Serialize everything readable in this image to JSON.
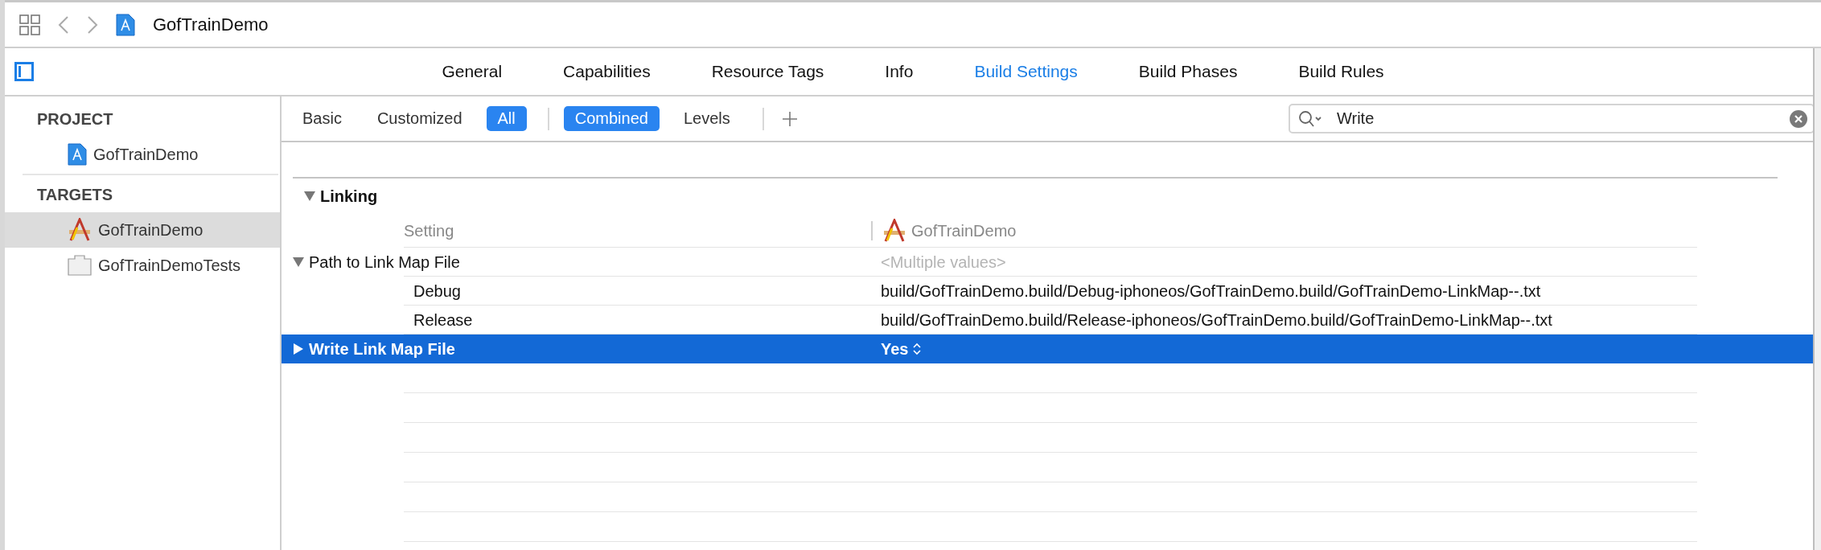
{
  "toolbar": {
    "title": "GofTrainDemo"
  },
  "tabs": [
    {
      "label": "General",
      "selected": false
    },
    {
      "label": "Capabilities",
      "selected": false
    },
    {
      "label": "Resource Tags",
      "selected": false
    },
    {
      "label": "Info",
      "selected": false
    },
    {
      "label": "Build Settings",
      "selected": true
    },
    {
      "label": "Build Phases",
      "selected": false
    },
    {
      "label": "Build Rules",
      "selected": false
    }
  ],
  "sidebar": {
    "sections": [
      {
        "heading": "PROJECT",
        "items": [
          {
            "label": "GofTrainDemo",
            "kind": "project",
            "selected": false
          }
        ]
      },
      {
        "heading": "TARGETS",
        "items": [
          {
            "label": "GofTrainDemo",
            "kind": "app",
            "selected": true
          },
          {
            "label": "GofTrainDemoTests",
            "kind": "tests",
            "selected": false
          }
        ]
      }
    ]
  },
  "filters": {
    "scope": [
      {
        "label": "Basic",
        "selected": false
      },
      {
        "label": "Customized",
        "selected": false
      },
      {
        "label": "All",
        "selected": true
      }
    ],
    "view": [
      {
        "label": "Combined",
        "selected": true
      },
      {
        "label": "Levels",
        "selected": false
      }
    ]
  },
  "search": {
    "value": "Write"
  },
  "settings": {
    "section": {
      "title": "Linking",
      "expanded": true
    },
    "columns": {
      "setting": "Setting",
      "target": "GofTrainDemo"
    },
    "rows": [
      {
        "name": "Path to Link Map File",
        "value": "<Multiple values>",
        "kind": "group",
        "expanded": true,
        "selected": false,
        "children": [
          {
            "name": "Debug",
            "value": "build/GofTrainDemo.build/Debug-iphoneos/GofTrainDemo.build/GofTrainDemo-LinkMap--.txt"
          },
          {
            "name": "Release",
            "value": "build/GofTrainDemo.build/Release-iphoneos/GofTrainDemo.build/GofTrainDemo-LinkMap--.txt"
          }
        ]
      },
      {
        "name": "Write Link Map File",
        "value": "Yes",
        "kind": "popup",
        "expanded": false,
        "selected": true
      }
    ]
  }
}
